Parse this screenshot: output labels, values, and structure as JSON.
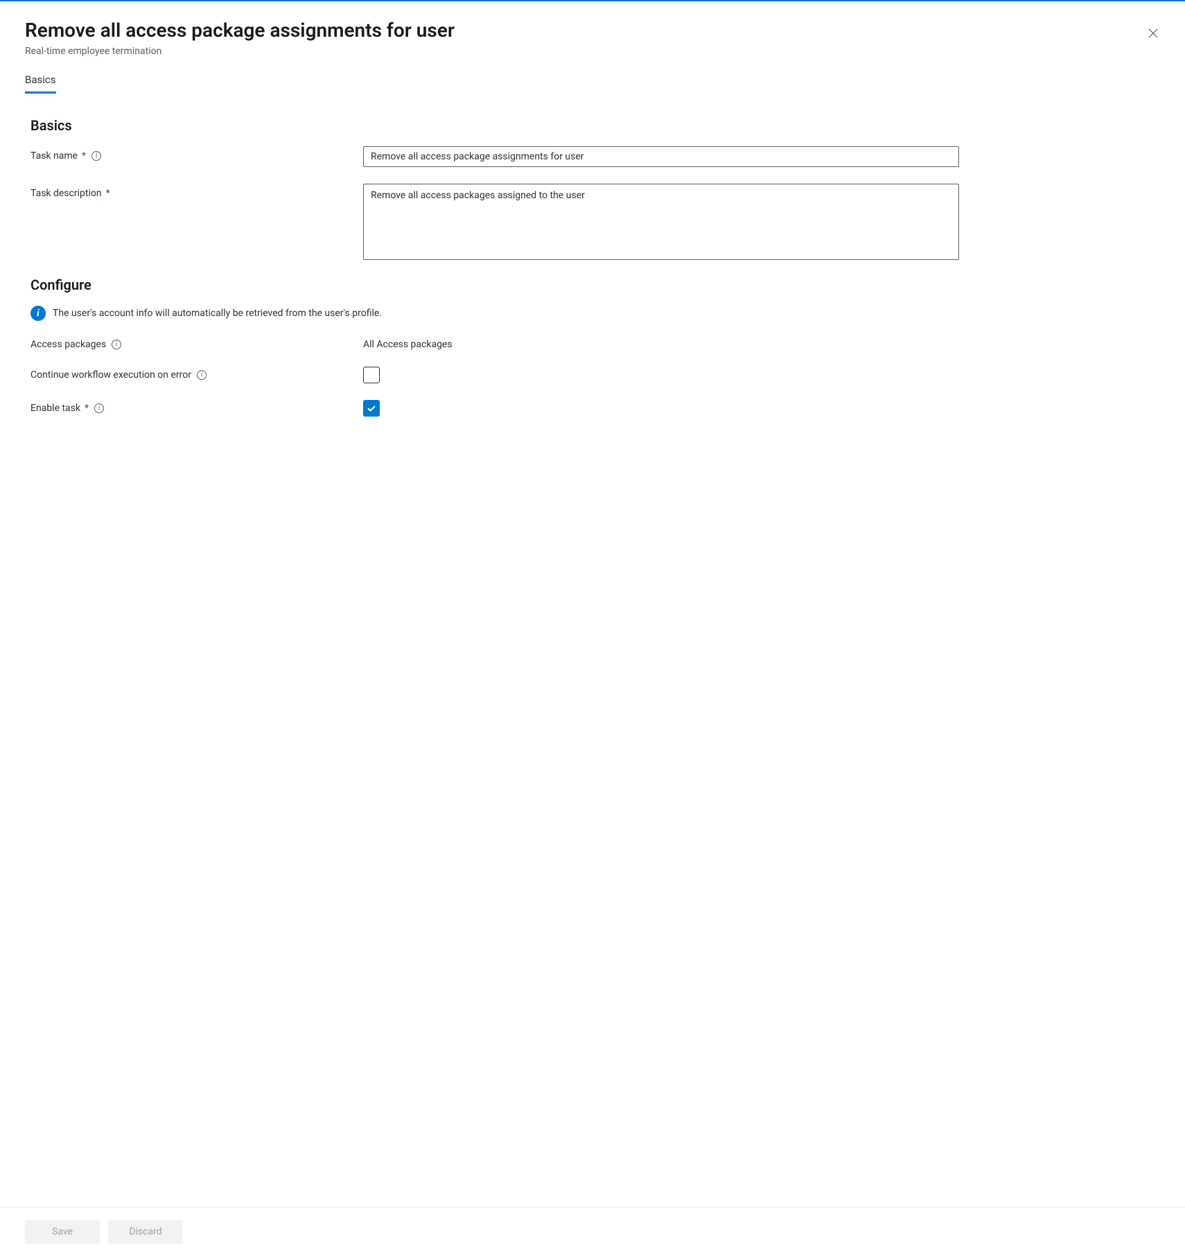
{
  "header": {
    "title": "Remove all access package assignments for user",
    "subtitle": "Real-time employee termination"
  },
  "tabs": {
    "basics": "Basics"
  },
  "sections": {
    "basics_heading": "Basics",
    "configure_heading": "Configure"
  },
  "fields": {
    "task_name": {
      "label": "Task name",
      "value": "Remove all access package assignments for user"
    },
    "task_description": {
      "label": "Task description",
      "value": "Remove all access packages assigned to the user"
    },
    "access_packages": {
      "label": "Access packages",
      "value": "All Access packages"
    },
    "continue_on_error": {
      "label": "Continue workflow execution on error",
      "checked": false
    },
    "enable_task": {
      "label": "Enable task",
      "checked": true
    }
  },
  "info_banner": "The user's account info will automatically be retrieved from the user's profile.",
  "footer": {
    "save": "Save",
    "discard": "Discard"
  }
}
